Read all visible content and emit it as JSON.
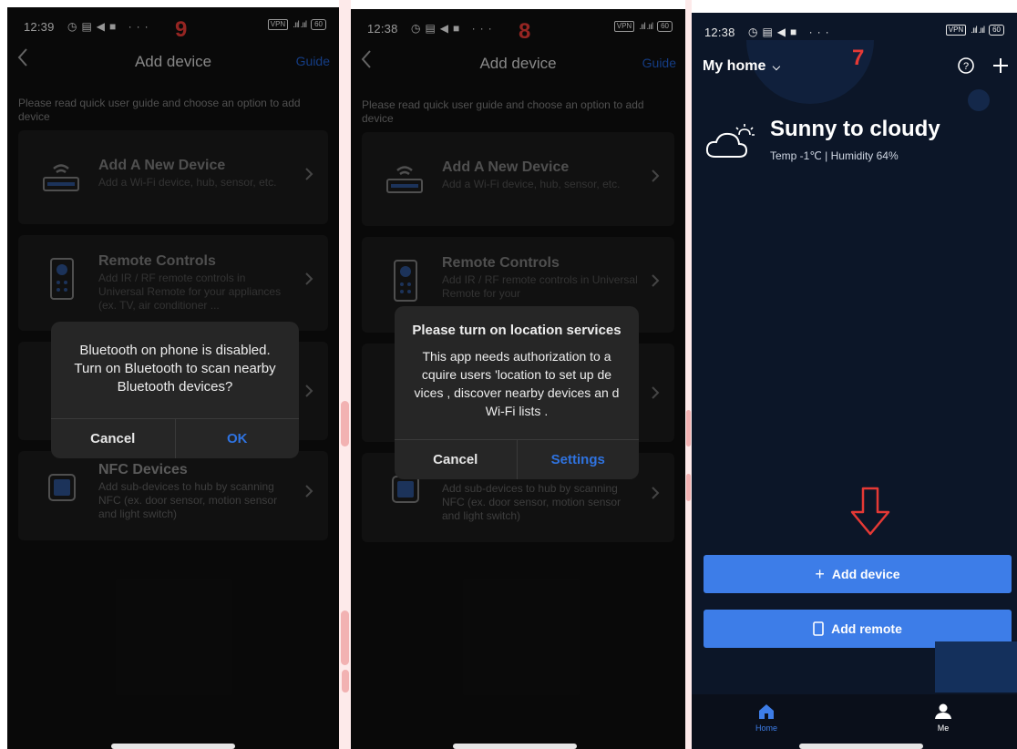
{
  "colors": {
    "accent": "#2f73e0",
    "button_blue": "#3d7de8",
    "step_red": "#e53935",
    "dark_bg": "#0f0f0f",
    "home_bg": "#0c1628"
  },
  "phones": {
    "p9": {
      "step": "9",
      "status": {
        "time": "12:39",
        "vpn": "VPN",
        "battery": "60"
      },
      "header": {
        "title": "Add device",
        "guide": "Guide"
      },
      "intro": "Please read quick user guide and choose an option to add device",
      "cards": {
        "new_device": {
          "title": "Add A New Device",
          "desc": "Add a Wi-Fi device, hub, sensor, etc."
        },
        "remote": {
          "title": "Remote Controls",
          "desc": "Add IR / RF remote controls in Universal Remote for your appliances (ex. TV, air conditioner ..."
        },
        "nfc": {
          "title": "NFC Devices",
          "desc": "Add sub-devices to hub by scanning NFC (ex. door sensor, motion sensor and light switch)"
        }
      },
      "dialog": {
        "message": "Bluetooth on phone is disabled. Turn on Bluetooth to scan nearby Bluetooth devices?",
        "cancel": "Cancel",
        "ok": "OK"
      }
    },
    "p8": {
      "step": "8",
      "status": {
        "time": "12:38",
        "vpn": "VPN",
        "battery": "60"
      },
      "header": {
        "title": "Add device",
        "guide": "Guide"
      },
      "intro": "Please read quick user guide and choose an option to add device",
      "cards": {
        "new_device": {
          "title": "Add A New Device",
          "desc": "Add a Wi-Fi device, hub, sensor, etc."
        },
        "remote": {
          "title": "Remote Controls",
          "desc": "Add IR / RF remote controls in Universal Remote for your"
        },
        "nfc": {
          "title": "",
          "desc": "Add sub-devices to hub by scanning NFC (ex. door sensor, motion sensor and light switch)"
        }
      },
      "dialog": {
        "title": "Please turn on location services",
        "message": "This app needs authorization to a cquire users 'location to set up de vices , discover nearby devices an d Wi-Fi lists .",
        "cancel": "Cancel",
        "settings": "Settings"
      }
    },
    "p7": {
      "step": "7",
      "status": {
        "time": "12:38",
        "vpn": "VPN",
        "battery": "60"
      },
      "home_title": "My home",
      "weather": {
        "title": "Sunny to cloudy",
        "sub": "Temp -1℃ | Humidity 64%"
      },
      "buttons": {
        "add_device": "Add device",
        "add_remote": "Add remote"
      },
      "nav": {
        "home": "Home",
        "me": "Me"
      }
    }
  }
}
